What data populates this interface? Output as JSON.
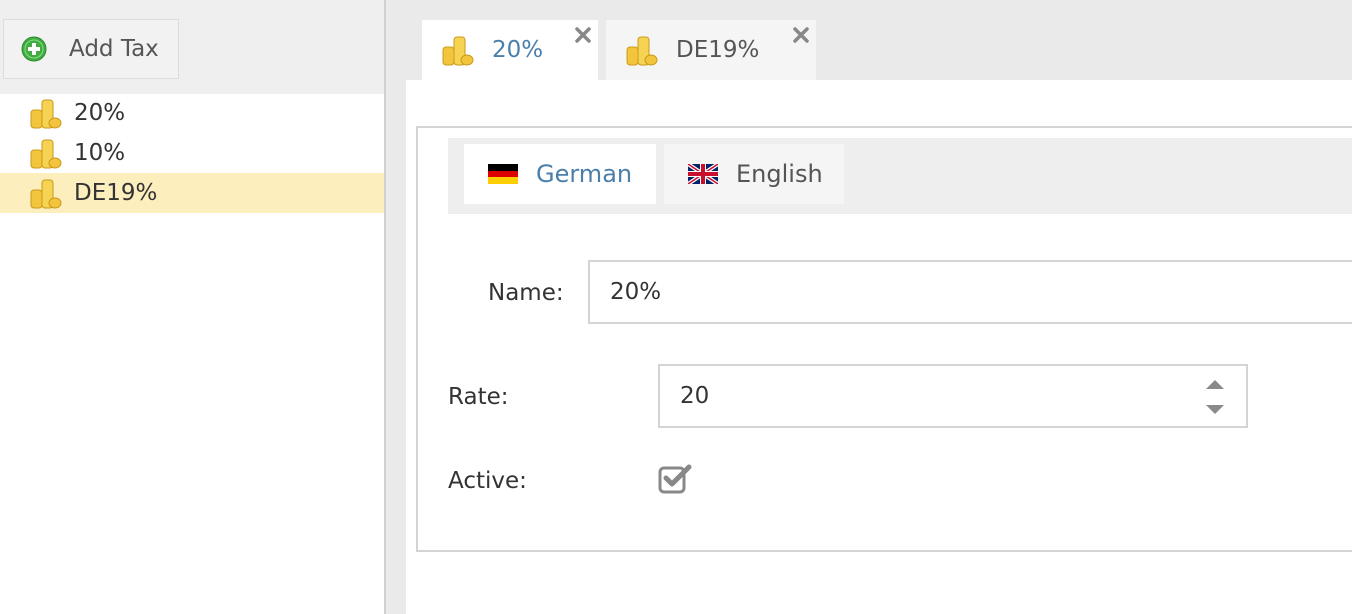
{
  "sidebar": {
    "add_button_label": "Add Tax",
    "items": [
      {
        "label": "20%",
        "icon": "coins-icon"
      },
      {
        "label": "10%",
        "icon": "coins-icon"
      },
      {
        "label": "DE19%",
        "icon": "coins-icon",
        "selected": true
      }
    ]
  },
  "tabs": [
    {
      "label": "20%",
      "active": true,
      "icon": "coins-icon"
    },
    {
      "label": "DE19%",
      "active": false,
      "icon": "coins-icon"
    }
  ],
  "language_tabs": [
    {
      "label": "German",
      "active": true,
      "icon": "flag-de-icon"
    },
    {
      "label": "English",
      "active": false,
      "icon": "flag-uk-icon"
    }
  ],
  "form": {
    "name_label": "Name:",
    "name_value": "20%",
    "rate_label": "Rate:",
    "rate_value": "20",
    "active_label": "Active:",
    "active_checked": true
  },
  "colors": {
    "accent": "#4a7fab",
    "selected_row": "#fdeebe",
    "add_icon": "#3fae3f"
  }
}
